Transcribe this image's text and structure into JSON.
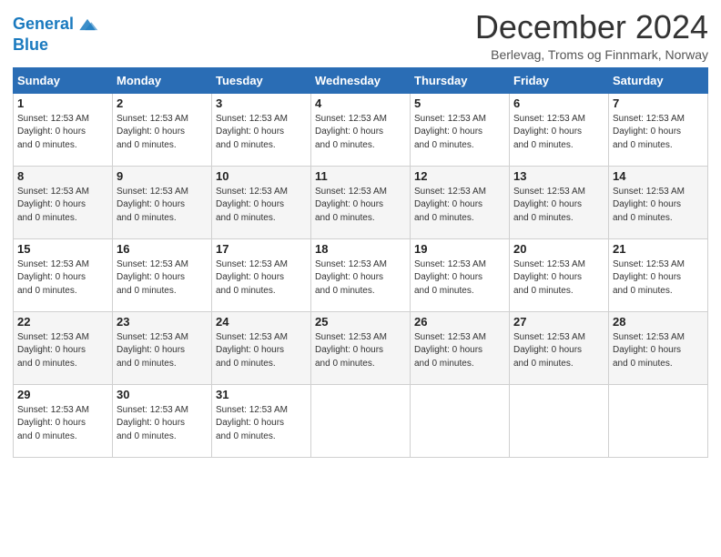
{
  "logo": {
    "line1": "General",
    "line2": "Blue"
  },
  "title": "December 2024",
  "location": "Berlevag, Troms og Finnmark, Norway",
  "days_of_week": [
    "Sunday",
    "Monday",
    "Tuesday",
    "Wednesday",
    "Thursday",
    "Friday",
    "Saturday"
  ],
  "day_info_text": "Sunset: 12:53 AM\nDaylight: 0 hours and 0 minutes.",
  "weeks": [
    [
      {
        "day": "1",
        "info": "Sunset: 12:53 AM\nDaylight: 0 hours\nand 0 minutes."
      },
      {
        "day": "2",
        "info": "Sunset: 12:53 AM\nDaylight: 0 hours\nand 0 minutes."
      },
      {
        "day": "3",
        "info": "Sunset: 12:53 AM\nDaylight: 0 hours\nand 0 minutes."
      },
      {
        "day": "4",
        "info": "Sunset: 12:53 AM\nDaylight: 0 hours\nand 0 minutes."
      },
      {
        "day": "5",
        "info": "Sunset: 12:53 AM\nDaylight: 0 hours\nand 0 minutes."
      },
      {
        "day": "6",
        "info": "Sunset: 12:53 AM\nDaylight: 0 hours\nand 0 minutes."
      },
      {
        "day": "7",
        "info": "Sunset: 12:53 AM\nDaylight: 0 hours\nand 0 minutes."
      }
    ],
    [
      {
        "day": "8",
        "info": "Sunset: 12:53 AM\nDaylight: 0 hours\nand 0 minutes."
      },
      {
        "day": "9",
        "info": "Sunset: 12:53 AM\nDaylight: 0 hours\nand 0 minutes."
      },
      {
        "day": "10",
        "info": "Sunset: 12:53 AM\nDaylight: 0 hours\nand 0 minutes."
      },
      {
        "day": "11",
        "info": "Sunset: 12:53 AM\nDaylight: 0 hours\nand 0 minutes."
      },
      {
        "day": "12",
        "info": "Sunset: 12:53 AM\nDaylight: 0 hours\nand 0 minutes."
      },
      {
        "day": "13",
        "info": "Sunset: 12:53 AM\nDaylight: 0 hours\nand 0 minutes."
      },
      {
        "day": "14",
        "info": "Sunset: 12:53 AM\nDaylight: 0 hours\nand 0 minutes."
      }
    ],
    [
      {
        "day": "15",
        "info": "Sunset: 12:53 AM\nDaylight: 0 hours\nand 0 minutes."
      },
      {
        "day": "16",
        "info": "Sunset: 12:53 AM\nDaylight: 0 hours\nand 0 minutes."
      },
      {
        "day": "17",
        "info": "Sunset: 12:53 AM\nDaylight: 0 hours\nand 0 minutes."
      },
      {
        "day": "18",
        "info": "Sunset: 12:53 AM\nDaylight: 0 hours\nand 0 minutes."
      },
      {
        "day": "19",
        "info": "Sunset: 12:53 AM\nDaylight: 0 hours\nand 0 minutes."
      },
      {
        "day": "20",
        "info": "Sunset: 12:53 AM\nDaylight: 0 hours\nand 0 minutes."
      },
      {
        "day": "21",
        "info": "Sunset: 12:53 AM\nDaylight: 0 hours\nand 0 minutes."
      }
    ],
    [
      {
        "day": "22",
        "info": "Sunset: 12:53 AM\nDaylight: 0 hours\nand 0 minutes."
      },
      {
        "day": "23",
        "info": "Sunset: 12:53 AM\nDaylight: 0 hours\nand 0 minutes."
      },
      {
        "day": "24",
        "info": "Sunset: 12:53 AM\nDaylight: 0 hours\nand 0 minutes."
      },
      {
        "day": "25",
        "info": "Sunset: 12:53 AM\nDaylight: 0 hours\nand 0 minutes."
      },
      {
        "day": "26",
        "info": "Sunset: 12:53 AM\nDaylight: 0 hours\nand 0 minutes."
      },
      {
        "day": "27",
        "info": "Sunset: 12:53 AM\nDaylight: 0 hours\nand 0 minutes."
      },
      {
        "day": "28",
        "info": "Sunset: 12:53 AM\nDaylight: 0 hours\nand 0 minutes."
      }
    ],
    [
      {
        "day": "29",
        "info": "Sunset: 12:53 AM\nDaylight: 0 hours\nand 0 minutes."
      },
      {
        "day": "30",
        "info": "Sunset: 12:53 AM\nDaylight: 0 hours\nand 0 minutes."
      },
      {
        "day": "31",
        "info": "Sunset: 12:53 AM\nDaylight: 0 hours\nand 0 minutes."
      },
      {
        "day": "",
        "info": ""
      },
      {
        "day": "",
        "info": ""
      },
      {
        "day": "",
        "info": ""
      },
      {
        "day": "",
        "info": ""
      }
    ]
  ]
}
